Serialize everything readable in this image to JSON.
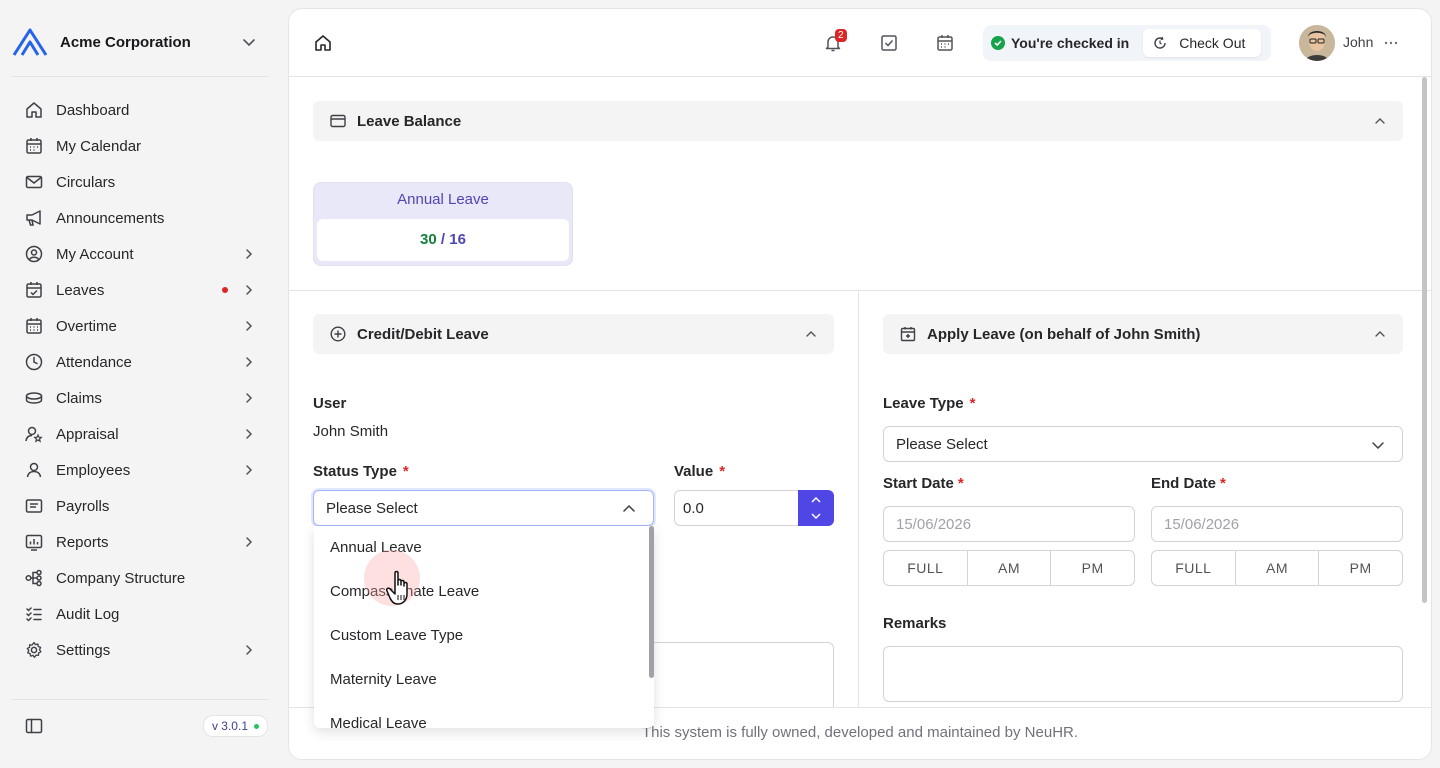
{
  "app": {
    "org_name": "Acme Corporation",
    "version": "v 3.0.1"
  },
  "sidebar": {
    "items": [
      {
        "label": "Dashboard",
        "icon": "home-icon"
      },
      {
        "label": "My Calendar",
        "icon": "calendar-icon"
      },
      {
        "label": "Circulars",
        "icon": "mail-icon"
      },
      {
        "label": "Announcements",
        "icon": "megaphone-icon"
      },
      {
        "label": "My Account",
        "icon": "user-circle-icon"
      },
      {
        "label": "Leaves",
        "icon": "calendar-check-icon"
      },
      {
        "label": "Overtime",
        "icon": "calendar-clock-icon"
      },
      {
        "label": "Attendance",
        "icon": "clock-icon"
      },
      {
        "label": "Claims",
        "icon": "coins-icon"
      },
      {
        "label": "Appraisal",
        "icon": "user-star-icon"
      },
      {
        "label": "Employees",
        "icon": "user-icon"
      },
      {
        "label": "Payrolls",
        "icon": "receipt-icon"
      },
      {
        "label": "Reports",
        "icon": "report-icon"
      },
      {
        "label": "Company Structure",
        "icon": "org-chart-icon"
      },
      {
        "label": "Audit Log",
        "icon": "list-check-icon"
      },
      {
        "label": "Settings",
        "icon": "gear-icon"
      }
    ]
  },
  "topbar": {
    "notification_count": "2",
    "checkin_status": "You're checked in",
    "checkout_label": "Check Out",
    "user_name": "John"
  },
  "leave_balance": {
    "title": "Leave Balance",
    "card_title": "Annual Leave",
    "used": "30",
    "separator": " / ",
    "total": "16"
  },
  "credit_debit": {
    "title": "Credit/Debit Leave",
    "user_label": "User",
    "user_value": "John Smith",
    "status_type_label": "Status Type",
    "status_type_value": "Please Select",
    "value_label": "Value",
    "value_value": "0.0",
    "required_mark": "*",
    "dropdown_options": [
      "Annual Leave",
      "Compassionate Leave",
      "Custom Leave Type",
      "Maternity Leave",
      "Medical Leave"
    ]
  },
  "apply_leave": {
    "title": "Apply Leave (on behalf of John Smith)",
    "leave_type_label": "Leave Type",
    "leave_type_value": "Please Select",
    "start_date_label": "Start Date",
    "start_date_placeholder": "15/06/2026",
    "end_date_label": "End Date",
    "end_date_placeholder": "15/06/2026",
    "day_parts": [
      "FULL",
      "AM",
      "PM"
    ],
    "remarks_label": "Remarks"
  },
  "footer": {
    "text": "This system is fully owned, developed and maintained by NeuHR."
  },
  "colors": {
    "accent": "#4f46e5",
    "success": "#16a34a",
    "danger": "#dc2626"
  }
}
